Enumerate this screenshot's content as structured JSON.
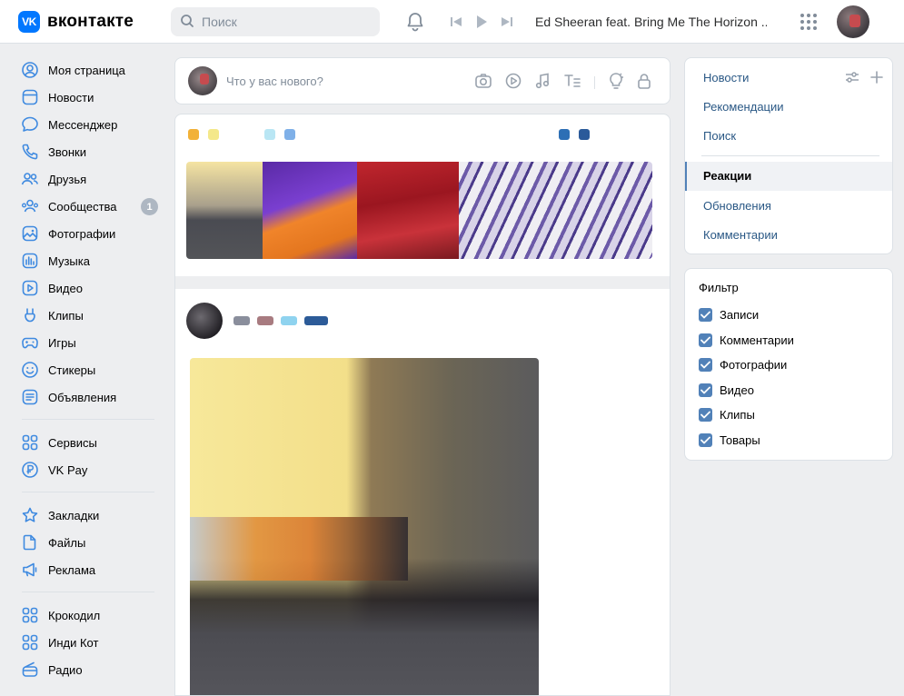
{
  "header": {
    "logo_mark": "VK",
    "logo_text": "вконтакте",
    "search_placeholder": "Поиск",
    "track": "Ed Sheeran feat. Bring Me The Horizon ..."
  },
  "sidebar": {
    "group1": [
      {
        "label": "Моя страница",
        "icon": "user-circle-icon"
      },
      {
        "label": "Новости",
        "icon": "newsfeed-icon"
      },
      {
        "label": "Мессенджер",
        "icon": "message-icon"
      },
      {
        "label": "Звонки",
        "icon": "phone-icon"
      },
      {
        "label": "Друзья",
        "icon": "friends-icon"
      },
      {
        "label": "Сообщества",
        "icon": "communities-icon",
        "badge": "1"
      },
      {
        "label": "Фотографии",
        "icon": "photo-icon"
      },
      {
        "label": "Музыка",
        "icon": "music-icon"
      },
      {
        "label": "Видео",
        "icon": "video-icon"
      },
      {
        "label": "Клипы",
        "icon": "clips-icon"
      },
      {
        "label": "Игры",
        "icon": "gamepad-icon"
      },
      {
        "label": "Стикеры",
        "icon": "smile-icon"
      },
      {
        "label": "Объявления",
        "icon": "ads-icon"
      }
    ],
    "group2": [
      {
        "label": "Сервисы",
        "icon": "services-icon"
      },
      {
        "label": "VK Pay",
        "icon": "vkpay-icon"
      }
    ],
    "group3": [
      {
        "label": "Закладки",
        "icon": "star-icon"
      },
      {
        "label": "Файлы",
        "icon": "file-icon"
      },
      {
        "label": "Реклама",
        "icon": "megaphone-icon"
      }
    ],
    "group4": [
      {
        "label": "Крокодил",
        "icon": "app-grid-icon"
      },
      {
        "label": "Инди Кот",
        "icon": "app-grid-icon"
      },
      {
        "label": "Радио",
        "icon": "radio-icon"
      }
    ]
  },
  "compose": {
    "placeholder": "Что у вас нового?"
  },
  "right_menu": {
    "items": [
      "Новости",
      "Рекомендации",
      "Поиск"
    ],
    "items2": [
      "Реакции",
      "Обновления",
      "Комментарии"
    ],
    "active": "Реакции"
  },
  "filter": {
    "title": "Фильтр",
    "options": [
      {
        "label": "Записи",
        "checked": true
      },
      {
        "label": "Комментарии",
        "checked": true
      },
      {
        "label": "Фотографии",
        "checked": true
      },
      {
        "label": "Видео",
        "checked": true
      },
      {
        "label": "Клипы",
        "checked": true
      },
      {
        "label": "Товары",
        "checked": true
      }
    ]
  },
  "colors": {
    "accent": "#0077ff",
    "link": "#2a5885",
    "checkbox": "#5181b8",
    "badge": "#aeb7c2",
    "page_bg": "#edeef0"
  }
}
